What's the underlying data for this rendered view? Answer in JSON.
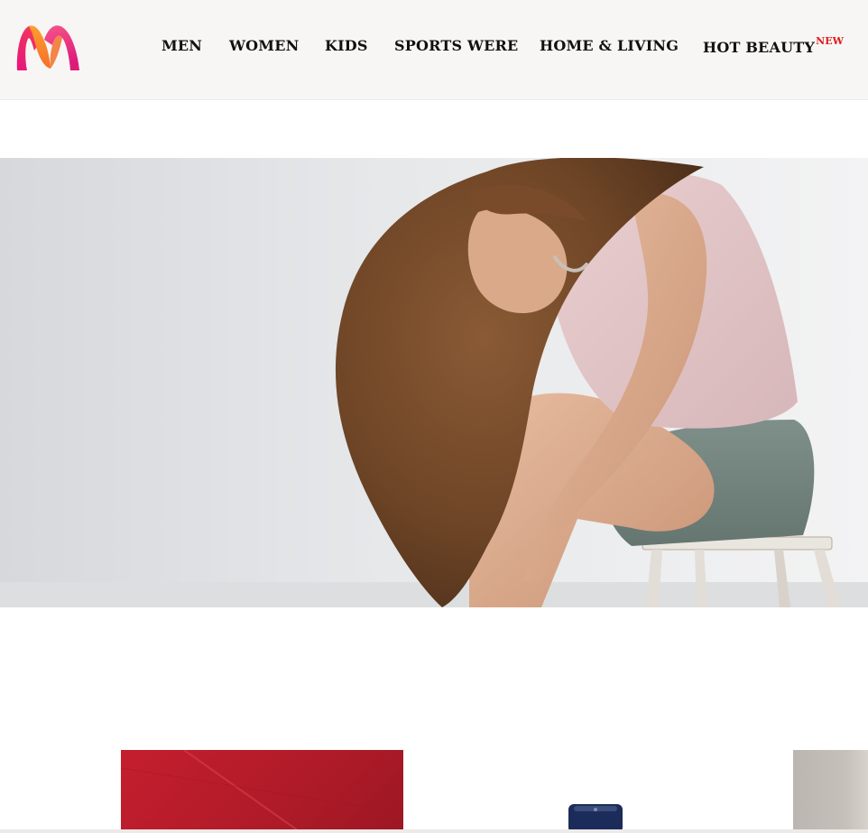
{
  "brand": {
    "logo_icon": "myntra-m-logo"
  },
  "nav": {
    "items": [
      {
        "label": "MEN"
      },
      {
        "label": "WOMEN"
      },
      {
        "label": "KIDS"
      },
      {
        "label": "SPORTS WERE"
      },
      {
        "label": "HOME & LIVING"
      },
      {
        "label": "HOT BEAUTY",
        "badge": "NEW"
      }
    ]
  },
  "colors": {
    "nav_background": "#f7f6f5",
    "badge": "#e01c1c",
    "logo_pink": "#e91e7a",
    "logo_orange": "#f47a20"
  }
}
